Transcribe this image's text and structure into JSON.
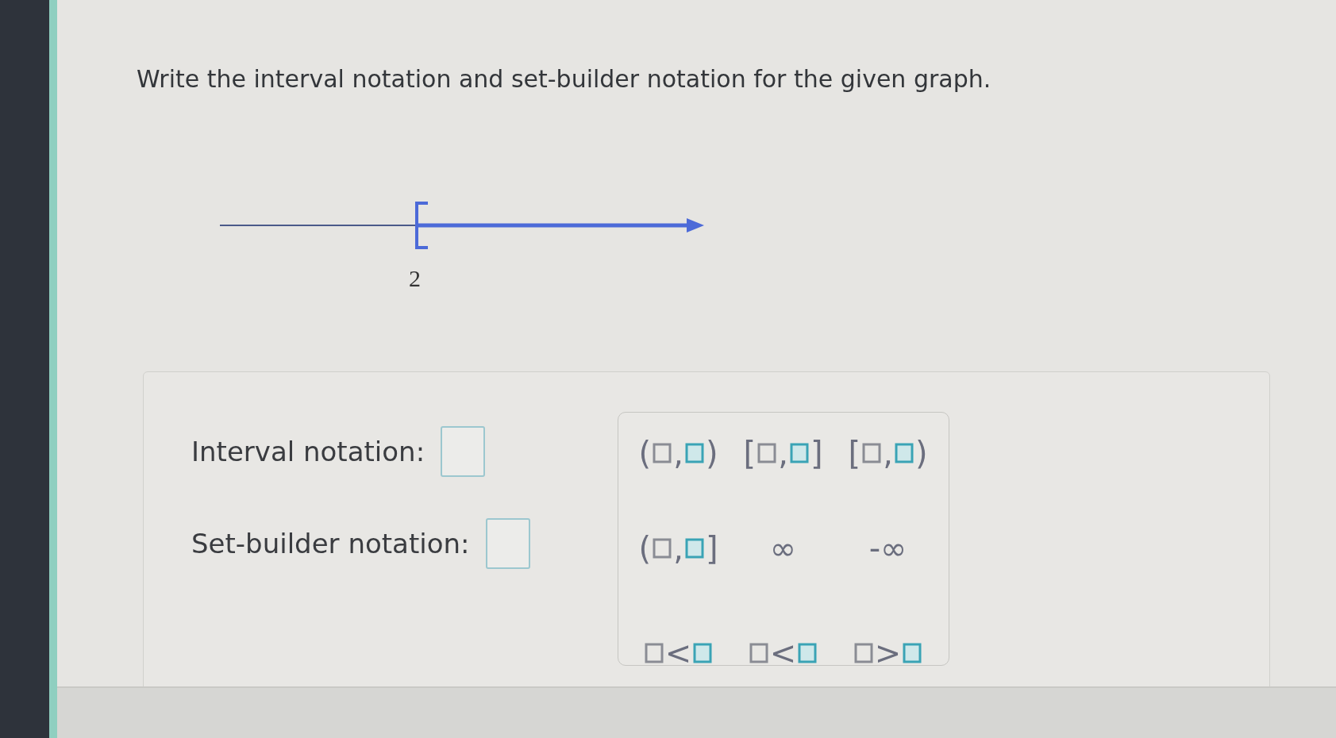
{
  "prompt": "Write the interval notation and set-builder notation for the given graph.",
  "graph": {
    "tick_label": "2"
  },
  "answers": [
    {
      "label": "Interval notation:"
    },
    {
      "label": "Set-builder notation:"
    }
  ],
  "keypad": [
    {
      "kind": "interval",
      "open": "(",
      "separator": ",",
      "close": ")"
    },
    {
      "kind": "interval",
      "open": "[",
      "separator": ",",
      "close": "]"
    },
    {
      "kind": "interval",
      "open": "[",
      "separator": ",",
      "close": ")"
    },
    {
      "kind": "interval",
      "open": "(",
      "separator": ",",
      "close": "]"
    },
    {
      "kind": "symbol",
      "text": "∞"
    },
    {
      "kind": "symbol",
      "text": "-∞"
    },
    {
      "kind": "relation",
      "text": "<"
    },
    {
      "kind": "relation",
      "text": "<"
    },
    {
      "kind": "relation",
      "text": ">"
    }
  ]
}
